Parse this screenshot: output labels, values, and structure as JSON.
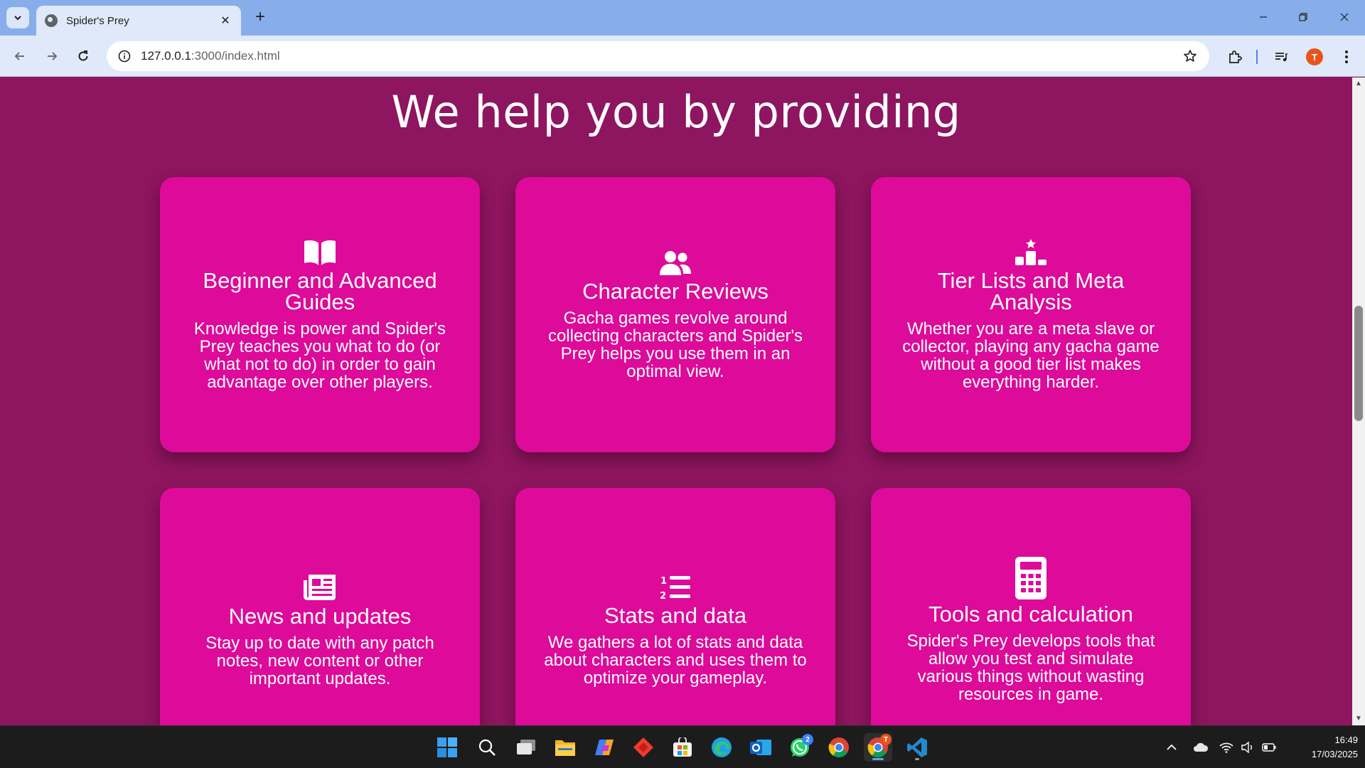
{
  "browser": {
    "tab_title": "Spider's Prey",
    "url_host": "127.0.0.1",
    "url_path": ":3000/index.html",
    "profile_initial": "T"
  },
  "page": {
    "section_title": "We help you by providing",
    "cards": [
      {
        "icon": "book-open-icon",
        "title": "Beginner and Advanced Guides",
        "text": "Knowledge is power and Spider's Prey teaches you what to do (or what not to do) in order to gain advantage over other players."
      },
      {
        "icon": "users-icon",
        "title": "Character Reviews",
        "text": "Gacha games revolve around collecting characters and Spider's Prey helps you use them in an optimal view."
      },
      {
        "icon": "ranking-star-icon",
        "title": "Tier Lists and Meta Analysis",
        "text": "Whether you are a meta slave or collector, playing any gacha game without a good tier list makes everything harder."
      },
      {
        "icon": "newspaper-icon",
        "title": "News and updates",
        "text": "Stay up to date with any patch notes, new content or other important updates."
      },
      {
        "icon": "list-ol-icon",
        "title": "Stats and data",
        "text": "We gathers a lot of stats and data about characters and uses them to optimize your gameplay."
      },
      {
        "icon": "calculator-icon",
        "title": "Tools and calculation",
        "text": "Spider's Prey develops tools that allow you test and simulate various things without wasting resources in game."
      }
    ],
    "colors": {
      "background": "#8e1560",
      "card": "#dd0a9a",
      "text": "#ffffff"
    }
  },
  "taskbar": {
    "apps": [
      "start-icon",
      "search-icon",
      "task-view-icon",
      "file-explorer-icon",
      "copilot-icon",
      "anydesk-icon",
      "microsoft-store-icon",
      "edge-icon",
      "outlook-icon",
      "whatsapp-icon",
      "chrome-icon",
      "chrome-profile-icon",
      "vscode-icon"
    ],
    "whatsapp_badge": "2",
    "chrome_badge": "T",
    "time": "16:49",
    "date": "17/03/2025"
  }
}
